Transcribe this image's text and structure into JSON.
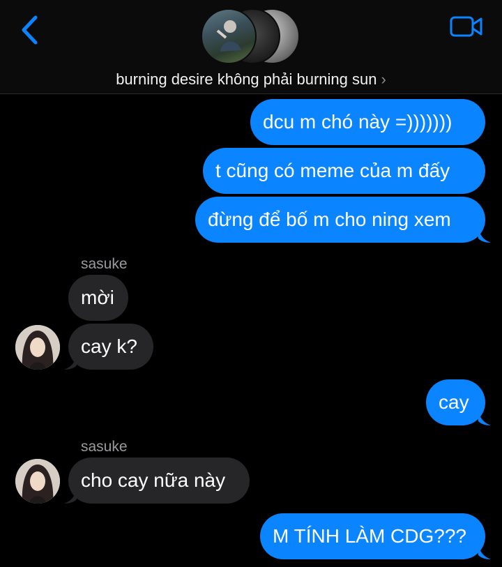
{
  "header": {
    "back_icon": "chevron-left-icon",
    "video_icon": "video-camera-icon",
    "group_name": "burning desire không phải burning sun",
    "title_chevron": "›",
    "accent": "#0a84ff"
  },
  "messages": [
    {
      "direction": "out",
      "text": "dcu m chó này =)))))))"
    },
    {
      "direction": "out",
      "text": "t cũng có meme của m đấy"
    },
    {
      "direction": "out",
      "text": "đừng để bố m cho ning xem"
    },
    {
      "direction": "in",
      "sender": "sasuke",
      "text": "mời"
    },
    {
      "direction": "in",
      "text": "cay k?"
    },
    {
      "direction": "out",
      "text": "cay"
    },
    {
      "direction": "in",
      "sender": "sasuke",
      "text": "cho cay nữa này"
    },
    {
      "direction": "out",
      "text": "M TÍNH LÀM CDG???"
    }
  ],
  "colors": {
    "outgoing_bubble": "#0a84ff",
    "incoming_bubble": "#262628",
    "background": "#000000"
  }
}
